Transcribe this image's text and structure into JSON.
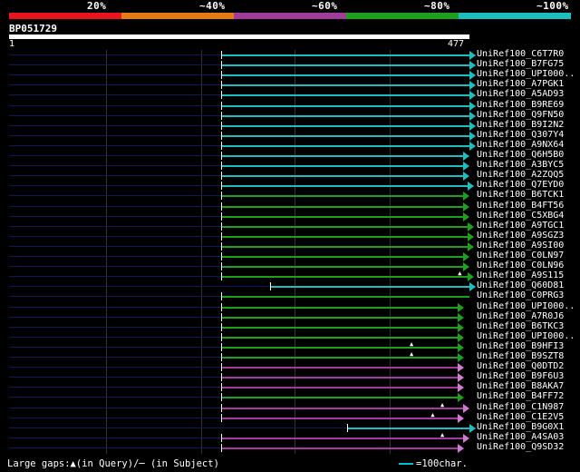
{
  "legend": {
    "items": [
      {
        "label": "20%",
        "color": "#e8141e"
      },
      {
        "label": "~40%",
        "color": "#e87a14"
      },
      {
        "label": "~60%",
        "color": "#a03c9a"
      },
      {
        "label": "~80%",
        "color": "#1ea01e"
      },
      {
        "label": "~100%",
        "color": "#1ebebe"
      }
    ]
  },
  "query": {
    "name": "BP051729",
    "start": "1",
    "end": "477"
  },
  "colors": {
    "cyan": "#1ebebe",
    "green": "#1ea01e",
    "purple": "#a03c9a",
    "purple_light": "#d07ad0"
  },
  "hits": [
    {
      "label": "UniRef100_C6T7R0",
      "start": 220,
      "end": 477,
      "color": "cyan",
      "full": true
    },
    {
      "label": "UniRef100_B7FG75",
      "start": 220,
      "end": 477,
      "color": "cyan",
      "full": true
    },
    {
      "label": "UniRef100_UPI000..",
      "start": 220,
      "end": 477,
      "color": "cyan",
      "full": true
    },
    {
      "label": "UniRef100_A7PGK1",
      "start": 220,
      "end": 477,
      "color": "cyan",
      "full": true
    },
    {
      "label": "UniRef100_A5AD93",
      "start": 220,
      "end": 477,
      "color": "cyan",
      "full": true
    },
    {
      "label": "UniRef100_B9RE69",
      "start": 220,
      "end": 477,
      "color": "cyan",
      "full": true
    },
    {
      "label": "UniRef100_Q9FN50",
      "start": 220,
      "end": 477,
      "color": "cyan",
      "full": true
    },
    {
      "label": "UniRef100_B9I2N2",
      "start": 220,
      "end": 477,
      "color": "cyan",
      "full": true
    },
    {
      "label": "UniRef100_Q307Y4",
      "start": 220,
      "end": 477,
      "color": "cyan",
      "full": true
    },
    {
      "label": "UniRef100_A9NX64",
      "start": 220,
      "end": 477,
      "color": "cyan",
      "full": true
    },
    {
      "label": "UniRef100_Q6H5B0",
      "start": 220,
      "end": 470,
      "color": "cyan",
      "full": true
    },
    {
      "label": "UniRef100_A3BYC5",
      "start": 220,
      "end": 470,
      "color": "cyan",
      "full": true
    },
    {
      "label": "UniRef100_A2ZQQ5",
      "start": 220,
      "end": 470,
      "color": "cyan",
      "full": true
    },
    {
      "label": "UniRef100_Q7EYD0",
      "start": 220,
      "end": 475,
      "color": "cyan",
      "full": true
    },
    {
      "label": "UniRef100_B6TCK1",
      "start": 220,
      "end": 470,
      "color": "green",
      "full": true
    },
    {
      "label": "UniRef100_B4FT56",
      "start": 220,
      "end": 470,
      "color": "green",
      "full": true
    },
    {
      "label": "UniRef100_C5XBG4",
      "start": 220,
      "end": 470,
      "color": "green",
      "full": true
    },
    {
      "label": "UniRef100_A9TGC1",
      "start": 220,
      "end": 475,
      "color": "green",
      "full": true
    },
    {
      "label": "UniRef100_A9SGZ3",
      "start": 220,
      "end": 475,
      "color": "green",
      "full": true
    },
    {
      "label": "UniRef100_A9SI00",
      "start": 220,
      "end": 475,
      "color": "green",
      "full": true
    },
    {
      "label": "UniRef100_C0LN97",
      "start": 220,
      "end": 470,
      "color": "green",
      "full": true
    },
    {
      "label": "UniRef100_C0LN96",
      "start": 220,
      "end": 470,
      "color": "green",
      "full": true
    },
    {
      "label": "UniRef100_A9S115",
      "start": 220,
      "end": 475,
      "color": "green",
      "full": true,
      "gap": 465
    },
    {
      "label": "UniRef100_Q60D81",
      "start": 270,
      "end": 477,
      "color": "cyan",
      "full": true
    },
    {
      "label": "UniRef100_C0PRG3",
      "start": 220,
      "end": 477,
      "color": "green",
      "full": false
    },
    {
      "label": "UniRef100_UPI000..",
      "start": 220,
      "end": 465,
      "color": "green",
      "full": true
    },
    {
      "label": "UniRef100_A7R0J6",
      "start": 220,
      "end": 465,
      "color": "green",
      "full": true
    },
    {
      "label": "UniRef100_B6TKC3",
      "start": 220,
      "end": 465,
      "color": "green",
      "full": true
    },
    {
      "label": "UniRef100_UPI000..",
      "start": 220,
      "end": 465,
      "color": "green",
      "full": true
    },
    {
      "label": "UniRef100_B9HFI3",
      "start": 220,
      "end": 465,
      "color": "green",
      "full": true,
      "gap": 415
    },
    {
      "label": "UniRef100_B9SZT8",
      "start": 220,
      "end": 465,
      "color": "green",
      "full": true,
      "gap": 415
    },
    {
      "label": "UniRef100_Q0DTD2",
      "start": 220,
      "end": 465,
      "color": "purple",
      "full": true
    },
    {
      "label": "UniRef100_B9F6U3",
      "start": 220,
      "end": 465,
      "color": "purple",
      "full": true
    },
    {
      "label": "UniRef100_B8AKA7",
      "start": 220,
      "end": 465,
      "color": "purple",
      "full": true
    },
    {
      "label": "UniRef100_B4FF72",
      "start": 220,
      "end": 465,
      "color": "green",
      "full": true
    },
    {
      "label": "UniRef100_C1N987",
      "start": 220,
      "end": 470,
      "color": "purple",
      "full": true,
      "gap": 447
    },
    {
      "label": "UniRef100_C1E2V5",
      "start": 220,
      "end": 465,
      "color": "purple",
      "full": true,
      "gap": 437
    },
    {
      "label": "UniRef100_B9G0X1",
      "start": 350,
      "end": 477,
      "color": "cyan",
      "full": true
    },
    {
      "label": "UniRef100_A4SA03",
      "start": 220,
      "end": 470,
      "color": "purple",
      "full": true,
      "gap": 447
    },
    {
      "label": "UniRef100_Q9SD32",
      "start": 220,
      "end": 465,
      "color": "purple",
      "full": true
    }
  ],
  "footer": {
    "text": "Large gaps:▲(in Query)/─ (in Subject)",
    "scale": "=100char."
  }
}
